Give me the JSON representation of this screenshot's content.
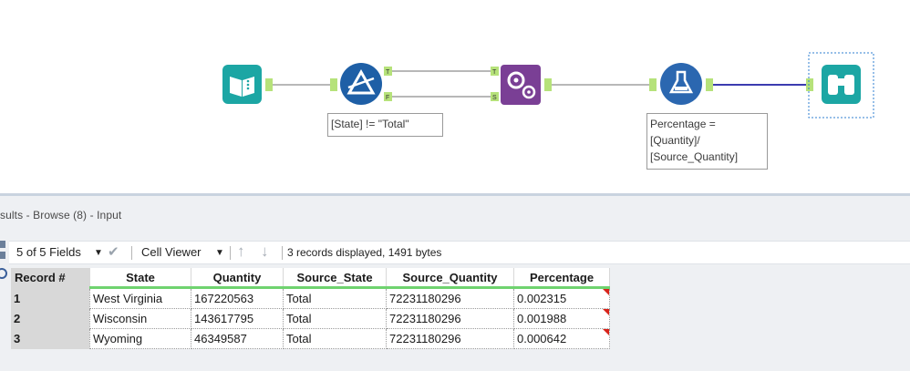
{
  "canvas": {
    "filter_annotation": "[State] != \"Total\"",
    "formula_annotation": "Percentage =\n[Quantity]/\n[Source_Quantity]",
    "anchors": {
      "true": "T",
      "false": "F",
      "join_true": "T",
      "join_source": "S"
    },
    "colors": {
      "input": "#1ca6a4",
      "filter": "#1e5fa6",
      "join": "#7a3f95",
      "formula": "#2b67b0",
      "browse": "#1ca6a4",
      "connector": "#a0a0a0",
      "selected_connector": "#3b3bb0",
      "anchor": "#b6e27a"
    }
  },
  "results": {
    "title": "sults - Browse (8) - Input",
    "toolbar": {
      "fields": "5 of 5 Fields",
      "viewer": "Cell Viewer",
      "status": "3 records displayed, 1491 bytes"
    },
    "columns": [
      "Record #",
      "State",
      "Quantity",
      "Source_State",
      "Source_Quantity",
      "Percentage"
    ],
    "rows": [
      {
        "record": "1",
        "state": "West Virginia",
        "quantity": "167220563",
        "source_state": "Total",
        "source_quantity": "72231180296",
        "percentage": "0.002315"
      },
      {
        "record": "2",
        "state": "Wisconsin",
        "quantity": "143617795",
        "source_state": "Total",
        "source_quantity": "72231180296",
        "percentage": "0.001988"
      },
      {
        "record": "3",
        "state": "Wyoming",
        "quantity": "46349587",
        "source_state": "Total",
        "source_quantity": "72231180296",
        "percentage": "0.000642"
      }
    ]
  }
}
